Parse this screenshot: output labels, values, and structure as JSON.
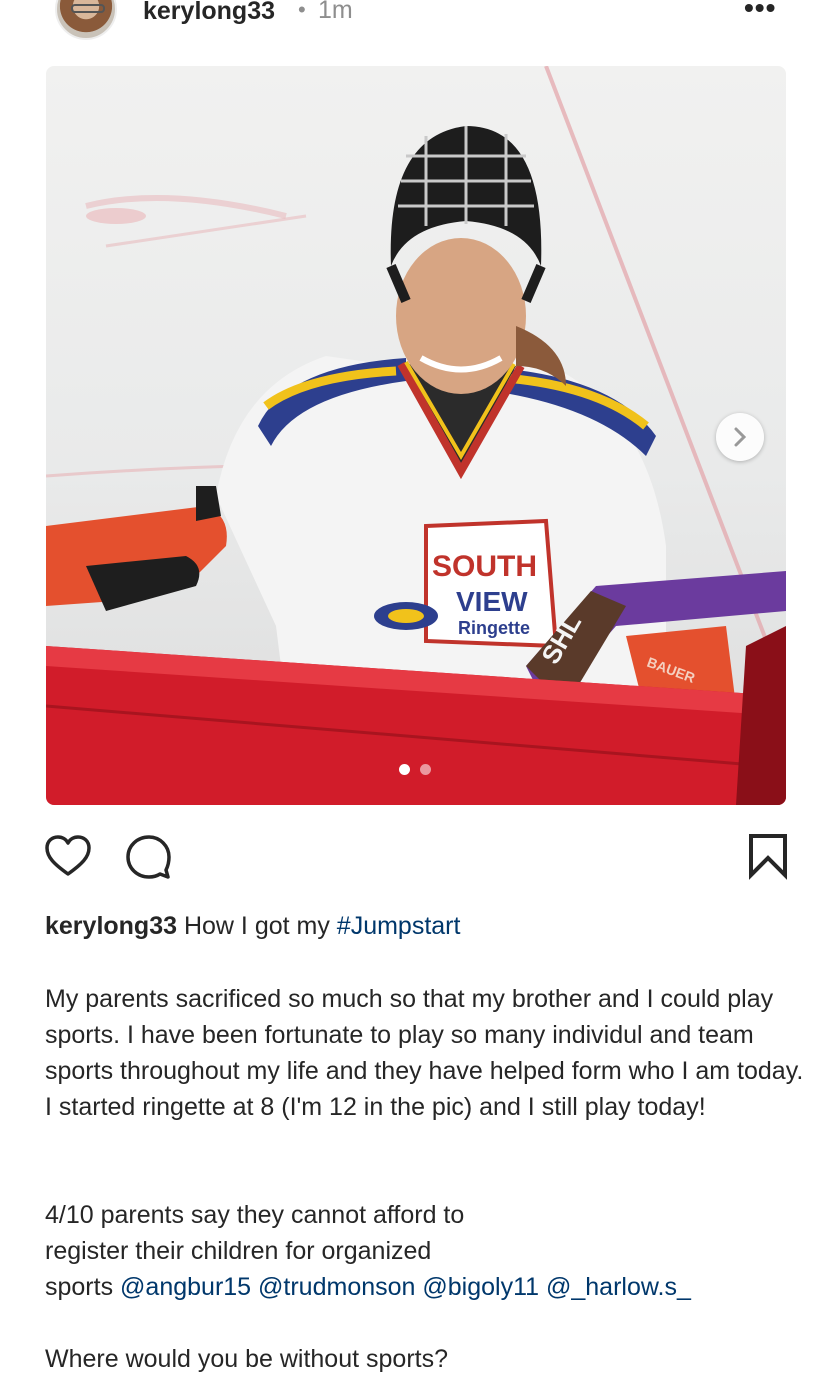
{
  "post": {
    "username": "kerylong33",
    "separator": "•",
    "time": "1m",
    "more": "•••"
  },
  "image": {
    "page_index": 1,
    "page_count": 2,
    "jersey_text_top": "SOUTH",
    "jersey_text_mid": "VIEW",
    "jersey_text_bottom": "Ringette",
    "stick_brand": "SHL",
    "pad_brand": "BAUER"
  },
  "caption": {
    "username": "kerylong33",
    "text": "How I got my",
    "hashtag": "#Jumpstart",
    "paragraph1": "My parents sacrificed so much so that my brother and I could play sports. I have been fortunate to play so many individul and team sports throughout my life and they have helped form who I am today. I started ringette at 8 (I'm 12 in the pic) and I still play today!",
    "paragraph2_line1": "4/10 parents say they cannot afford to",
    "paragraph2_line2": "register their children for organized",
    "paragraph2_line3": "sports",
    "mentions": [
      "@angbur15",
      "@trudmonson",
      "@bigoly11",
      "@_harlow.s_"
    ],
    "paragraph3": "Where would you be without sports?"
  },
  "colors": {
    "link": "#00376b",
    "text": "#262626",
    "muted": "#8e8e8e"
  }
}
